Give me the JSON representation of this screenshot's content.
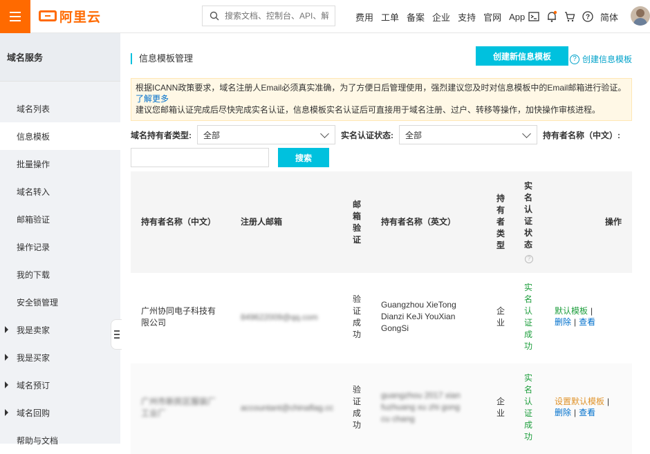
{
  "header": {
    "logo_text": "阿里云",
    "search_placeholder": "搜索文档、控制台、API、解",
    "links": [
      "费用",
      "工单",
      "备案",
      "企业",
      "支持",
      "官网",
      "App"
    ],
    "lang": "简体"
  },
  "sidebar": {
    "title": "域名服务",
    "items": [
      {
        "label": "域名列表",
        "expandable": false
      },
      {
        "label": "信息模板",
        "expandable": false
      },
      {
        "label": "批量操作",
        "expandable": false
      },
      {
        "label": "域名转入",
        "expandable": false
      },
      {
        "label": "邮箱验证",
        "expandable": false
      },
      {
        "label": "操作记录",
        "expandable": false
      },
      {
        "label": "我的下载",
        "expandable": false
      },
      {
        "label": "安全锁管理",
        "expandable": false
      },
      {
        "label": "我是卖家",
        "expandable": true
      },
      {
        "label": "我是买家",
        "expandable": true
      },
      {
        "label": "域名预订",
        "expandable": true
      },
      {
        "label": "域名回购",
        "expandable": true
      },
      {
        "label": "帮助与文档",
        "expandable": false
      }
    ]
  },
  "main": {
    "title": "信息模板管理",
    "create_button": "创建新信息模板",
    "help_link": "创建信息模板",
    "notice_line1": "根据ICANN政策要求，域名注册人Email必须真实准确，为了方便日后管理使用，强烈建议您及时对信息模板中的Email邮箱进行验证。",
    "notice_link": "了解更多",
    "notice_line2": "建议您邮箱认证完成后尽快完成实名认证，信息模板实名认证后可直接用于域名注册、过户、转移等操作，加快操作审核进程。",
    "filters": {
      "holder_type_label": "域名持有者类型:",
      "holder_type_value": "全部",
      "verify_status_label": "实名认证状态:",
      "verify_status_value": "全部",
      "holder_name_label": "持有者名称（中文）:",
      "search_button": "搜索"
    },
    "table": {
      "headers": {
        "holder_cn": "持有者名称（中文）",
        "email": "注册人邮箱",
        "email_verify": "邮箱验证",
        "holder_en": "持有者名称（英文）",
        "holder_type": "持有者类型",
        "verify_status": "实名认证状态",
        "actions": "操作"
      },
      "rows": [
        {
          "holder_cn": "广州协同电子科技有限公司",
          "email": "849622009@qq.com",
          "email_verify": "验证成功",
          "holder_en": "Guangzhou XieTong Dianzi KeJi YouXian GongSi",
          "holder_type": "企业",
          "verify_status": "实名认证成功",
          "action1": "默认模板",
          "action2": "删除",
          "action3": "查看"
        },
        {
          "holder_cn": "广州市新民区服装厂工业厂",
          "email": "accountant@chinaflag.cc",
          "email_verify": "验证成功",
          "holder_en": "guangzhou 2017 xian fuzhuang xu zhi gong cu chang",
          "holder_type": "企业",
          "verify_status": "实名认证成功",
          "action1": "设置默认模板",
          "action2": "删除",
          "action3": "查看"
        }
      ]
    }
  }
}
